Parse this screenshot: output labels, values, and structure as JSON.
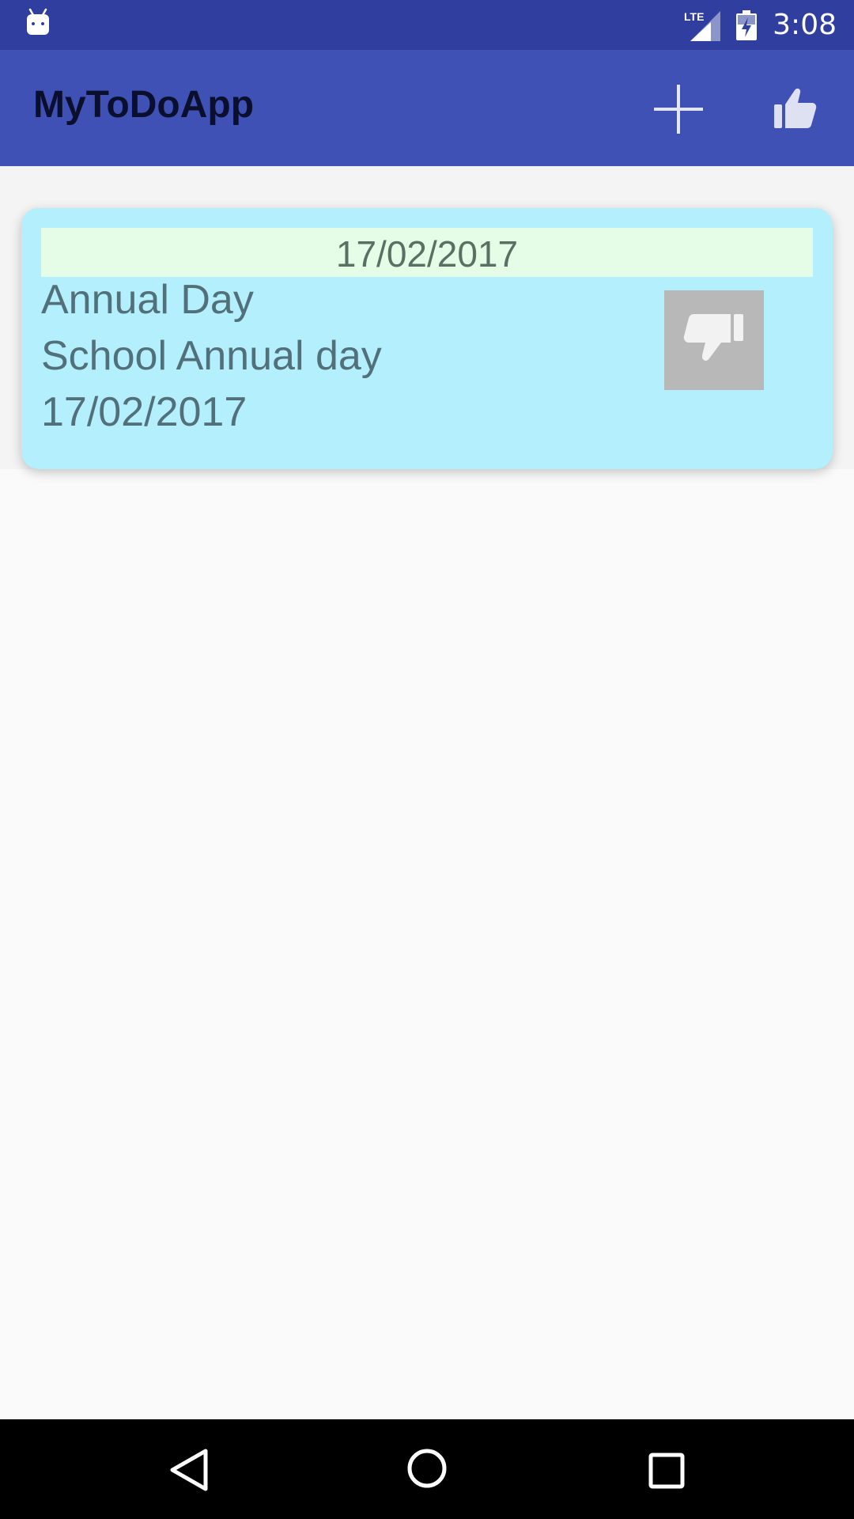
{
  "status_bar": {
    "network_label": "LTE",
    "time": "3:08"
  },
  "app_bar": {
    "title": "MyToDoApp",
    "actions": [
      {
        "name": "add",
        "icon": "plus-icon"
      },
      {
        "name": "like",
        "icon": "thumbs-up-icon"
      }
    ]
  },
  "todo_list": {
    "items": [
      {
        "header_date": "17/02/2017",
        "title": "Annual Day",
        "description": "School Annual day",
        "date": "17/02/2017",
        "status_icon": "thumbs-down-icon"
      }
    ]
  },
  "nav_bar": {
    "buttons": [
      "back-icon",
      "home-icon",
      "recents-icon"
    ]
  },
  "colors": {
    "status_bar": "#303F9F",
    "app_bar": "#3F51B5",
    "card_background": "#B3EFFC",
    "card_header": "#E5FDE6",
    "card_text": "#52707A",
    "dislike_background": "#B8B8B8"
  }
}
